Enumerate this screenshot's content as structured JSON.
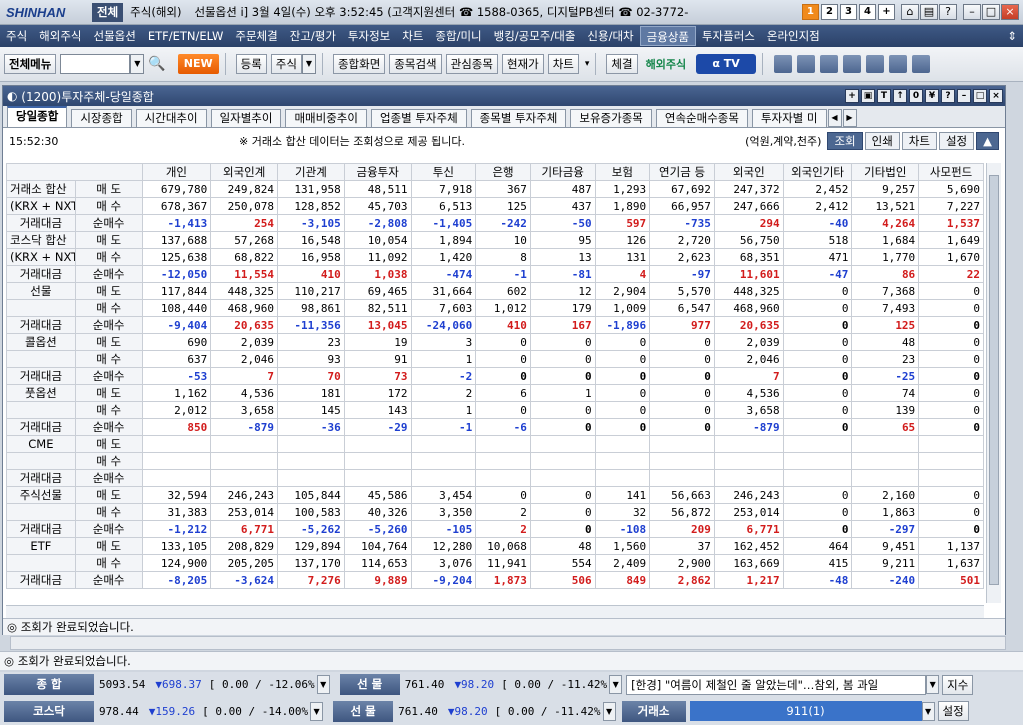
{
  "titlebar": {
    "brand": "SHINHAN",
    "tabs": [
      "전체",
      "주식(해외)"
    ],
    "info": "선물옵션 i] 3월 4일(수) 오후 3:52:45 (고객지원센터 ☎ 1588-0365, 디지털PB센터 ☎ 02-3772-",
    "nums": [
      "1",
      "2",
      "3",
      "4",
      "+"
    ]
  },
  "menu": [
    "주식",
    "해외주식",
    "선물옵션",
    "ETF/ETN/ELW",
    "주문체결",
    "잔고/평가",
    "투자정보",
    "차트",
    "종합/미니",
    "뱅킹/공모주/대출",
    "신용/대차",
    "금융상품",
    "투자플러스",
    "온라인지점"
  ],
  "toolbar": {
    "all_menu": "전체메뉴",
    "new": "NEW",
    "register": "등록",
    "stock": "주식",
    "buttons": [
      "종합화면",
      "종목검색",
      "관심종목",
      "현재가",
      "차트"
    ],
    "settle": "체결",
    "overseas": "해외주식"
  },
  "window": {
    "title": "(1200)투자주체-당일종합",
    "tabs": [
      "당일종합",
      "시장종합",
      "시간대추이",
      "일자별추이",
      "매매비중추이",
      "업종별 투자주체",
      "종목별 투자주체",
      "보유증가종목",
      "연속순매수종목",
      "투자자별 미"
    ]
  },
  "info": {
    "time": "15:52:30",
    "notice": "※ 거래소 합산 데이터는 조회성으로 제공 됩니다.",
    "unit": "(억원,계약,천주)",
    "buttons": [
      "조회",
      "인쇄",
      "차트",
      "설정",
      "▲"
    ]
  },
  "columns": [
    "개인",
    "외국인계",
    "기관계",
    "금융투자",
    "투신",
    "은행",
    "기타금융",
    "보험",
    "연기금 등",
    "외국인",
    "외국인기타",
    "기타법인",
    "사모펀드"
  ],
  "groups": [
    {
      "name": "거래소 합산",
      "name2": "(KRX + NXT)",
      "rows": [
        {
          "t": "매  도",
          "v": [
            "679,780",
            "249,824",
            "131,958",
            "48,511",
            "7,918",
            "367",
            "487",
            "1,293",
            "67,692",
            "247,372",
            "2,452",
            "9,257",
            "5,690"
          ]
        },
        {
          "t": "매  수",
          "v": [
            "678,367",
            "250,078",
            "128,852",
            "45,703",
            "6,513",
            "125",
            "437",
            "1,890",
            "66,957",
            "247,666",
            "2,412",
            "13,521",
            "7,227"
          ]
        },
        {
          "t": "순매수",
          "v": [
            "-1,413",
            "254",
            "-3,105",
            "-2,808",
            "-1,405",
            "-242",
            "-50",
            "597",
            "-735",
            "294",
            "-40",
            "4,264",
            "1,537"
          ]
        }
      ]
    },
    {
      "name": "코스닥 합산",
      "name2": "(KRX + NXT)",
      "rows": [
        {
          "t": "매  도",
          "v": [
            "137,688",
            "57,268",
            "16,548",
            "10,054",
            "1,894",
            "10",
            "95",
            "126",
            "2,720",
            "56,750",
            "518",
            "1,684",
            "1,649"
          ]
        },
        {
          "t": "매  수",
          "v": [
            "125,638",
            "68,822",
            "16,958",
            "11,092",
            "1,420",
            "8",
            "13",
            "131",
            "2,623",
            "68,351",
            "471",
            "1,770",
            "1,670"
          ]
        },
        {
          "t": "순매수",
          "v": [
            "-12,050",
            "11,554",
            "410",
            "1,038",
            "-474",
            "-1",
            "-81",
            "4",
            "-97",
            "11,601",
            "-47",
            "86",
            "22"
          ]
        }
      ]
    },
    {
      "name": "선물",
      "name2": "",
      "rows": [
        {
          "t": "매  도",
          "v": [
            "117,844",
            "448,325",
            "110,217",
            "69,465",
            "31,664",
            "602",
            "12",
            "2,904",
            "5,570",
            "448,325",
            "0",
            "7,368",
            "0"
          ]
        },
        {
          "t": "매  수",
          "v": [
            "108,440",
            "468,960",
            "98,861",
            "82,511",
            "7,603",
            "1,012",
            "179",
            "1,009",
            "6,547",
            "468,960",
            "0",
            "7,493",
            "0"
          ]
        },
        {
          "t": "순매수",
          "v": [
            "-9,404",
            "20,635",
            "-11,356",
            "13,045",
            "-24,060",
            "410",
            "167",
            "-1,896",
            "977",
            "20,635",
            "0",
            "125",
            "0"
          ]
        }
      ]
    },
    {
      "name": "콜옵션",
      "name2": "",
      "rows": [
        {
          "t": "매  도",
          "v": [
            "690",
            "2,039",
            "23",
            "19",
            "3",
            "0",
            "0",
            "0",
            "0",
            "2,039",
            "0",
            "48",
            "0"
          ]
        },
        {
          "t": "매  수",
          "v": [
            "637",
            "2,046",
            "93",
            "91",
            "1",
            "0",
            "0",
            "0",
            "0",
            "2,046",
            "0",
            "23",
            "0"
          ]
        },
        {
          "t": "순매수",
          "v": [
            "-53",
            "7",
            "70",
            "73",
            "-2",
            "0",
            "0",
            "0",
            "0",
            "7",
            "0",
            "-25",
            "0"
          ]
        }
      ]
    },
    {
      "name": "풋옵션",
      "name2": "",
      "rows": [
        {
          "t": "매  도",
          "v": [
            "1,162",
            "4,536",
            "181",
            "172",
            "2",
            "6",
            "1",
            "0",
            "0",
            "4,536",
            "0",
            "74",
            "0"
          ]
        },
        {
          "t": "매  수",
          "v": [
            "2,012",
            "3,658",
            "145",
            "143",
            "1",
            "0",
            "0",
            "0",
            "0",
            "3,658",
            "0",
            "139",
            "0"
          ]
        },
        {
          "t": "순매수",
          "v": [
            "850",
            "-879",
            "-36",
            "-29",
            "-1",
            "-6",
            "0",
            "0",
            "0",
            "-879",
            "0",
            "65",
            "0"
          ]
        }
      ]
    },
    {
      "name": "CME",
      "name2": "",
      "rows": [
        {
          "t": "매  도",
          "v": [
            "",
            "",
            "",
            "",
            "",
            "",
            "",
            "",
            "",
            "",
            "",
            "",
            ""
          ]
        },
        {
          "t": "매  수",
          "v": [
            "",
            "",
            "",
            "",
            "",
            "",
            "",
            "",
            "",
            "",
            "",
            "",
            ""
          ]
        },
        {
          "t": "순매수",
          "v": [
            "",
            "",
            "",
            "",
            "",
            "",
            "",
            "",
            "",
            "",
            "",
            "",
            ""
          ]
        }
      ]
    },
    {
      "name": "주식선물",
      "name2": "",
      "rows": [
        {
          "t": "매  도",
          "v": [
            "32,594",
            "246,243",
            "105,844",
            "45,586",
            "3,454",
            "0",
            "0",
            "141",
            "56,663",
            "246,243",
            "0",
            "2,160",
            "0"
          ]
        },
        {
          "t": "매  수",
          "v": [
            "31,383",
            "253,014",
            "100,583",
            "40,326",
            "3,350",
            "2",
            "0",
            "32",
            "56,872",
            "253,014",
            "0",
            "1,863",
            "0"
          ]
        },
        {
          "t": "순매수",
          "v": [
            "-1,212",
            "6,771",
            "-5,262",
            "-5,260",
            "-105",
            "2",
            "0",
            "-108",
            "209",
            "6,771",
            "0",
            "-297",
            "0"
          ]
        }
      ]
    },
    {
      "name": "ETF",
      "name2": "",
      "rows": [
        {
          "t": "매  도",
          "v": [
            "133,105",
            "208,829",
            "129,894",
            "104,764",
            "12,280",
            "10,068",
            "48",
            "1,560",
            "37",
            "162,452",
            "464",
            "9,451",
            "1,137"
          ]
        },
        {
          "t": "매  수",
          "v": [
            "124,900",
            "205,205",
            "137,170",
            "114,653",
            "3,076",
            "11,941",
            "554",
            "2,409",
            "2,900",
            "163,669",
            "415",
            "9,211",
            "1,637"
          ]
        },
        {
          "t": "순매수",
          "v": [
            "-8,205",
            "-3,624",
            "7,276",
            "9,889",
            "-9,204",
            "1,873",
            "506",
            "849",
            "2,862",
            "1,217",
            "-48",
            "-240",
            "501"
          ]
        }
      ]
    }
  ],
  "trade_label": "거래대금",
  "status": "조회가 완료되었습니다.",
  "status2": "조회가 완료되었습니다.",
  "ticker1": {
    "label": "종  합",
    "v1": "5093.54",
    "v2": "▼698.37",
    "v3": "[ 0.00  / -12.06%",
    "label2": "선  물",
    "v4": "761.40",
    "v5": "▼98.20",
    "v6": "[ 0.00  / -11.42%",
    "news": "[한경] \"여름이 제철인 줄 알았는데\"…참외, 봄 과일",
    "btn": "지수"
  },
  "ticker2": {
    "label": "코스닥",
    "v1": "978.44",
    "v2": "▼159.26",
    "v3": "[ 0.00  / -14.00%",
    "label2": "선  물",
    "v4": "761.40",
    "v5": "▼98.20",
    "v6": "[ 0.00  / -11.42%",
    "label3": "거래소",
    "bar": "911(1)",
    "btn": "설정"
  }
}
